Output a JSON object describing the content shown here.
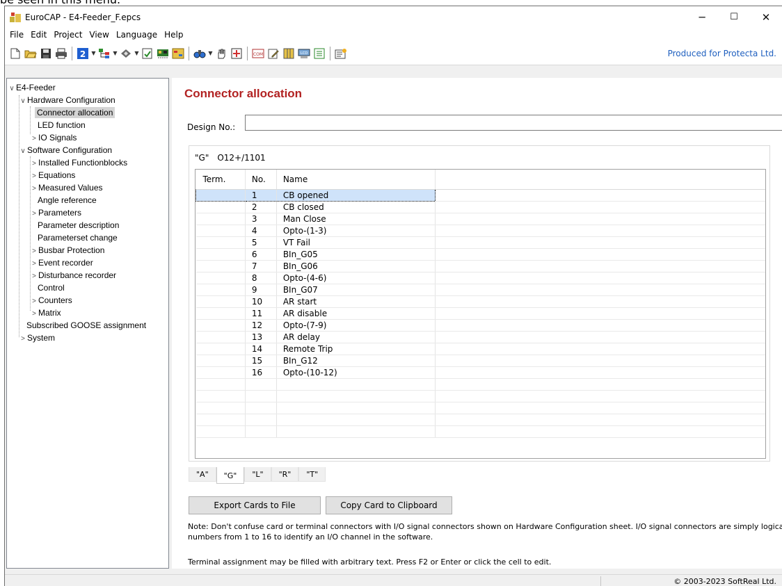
{
  "clipped_top_text": "be seen in this menu.",
  "window": {
    "title": "EuroCAP - E4-Feeder_F.epcs",
    "controls": {
      "minimize": "─",
      "maximize": "☐",
      "close": "✕"
    }
  },
  "menu": [
    "File",
    "Edit",
    "Project",
    "View",
    "Language",
    "Help"
  ],
  "toolbar": {
    "produced_for": "Produced for Protecta Ltd.",
    "icons": [
      "new-file-icon",
      "open-folder-icon",
      "save-icon",
      "print-icon",
      "number-badge-icon",
      "hardware-tree-icon",
      "component-icon",
      "document-check-icon",
      "io-card-icon",
      "configuration-icon",
      "binoculars-icon",
      "hand-icon",
      "zoom-fit-icon",
      "com-icon",
      "edit-icon",
      "columns-icon",
      "lcd-icon",
      "list-icon",
      "properties-icon"
    ],
    "badge_text": "2"
  },
  "tree": {
    "root": "E4-Feeder",
    "hardware": "Hardware Configuration",
    "connector": "Connector allocation",
    "led": "LED function",
    "io": "IO Signals",
    "software": "Software Configuration",
    "installed": "Installed Functionblocks",
    "equations": "Equations",
    "measured": "Measured Values",
    "angle": "Angle reference",
    "parameters": "Parameters",
    "paramdesc": "Parameter description",
    "paramset": "Parameterset change",
    "busbar": "Busbar Protection",
    "event": "Event recorder",
    "disturbance": "Disturbance recorder",
    "control": "Control",
    "counters": "Counters",
    "matrix": "Matrix",
    "goose": "Subscribed GOOSE assignment",
    "system": "System"
  },
  "page": {
    "title": "Connector allocation",
    "design_label": "Design No.:",
    "design_value": ""
  },
  "card": {
    "letter": "\"G\"",
    "code": "O12+/1101",
    "columns": [
      "Term.",
      "No.",
      "Name"
    ],
    "rows": [
      {
        "term": "",
        "no": "1",
        "name": "CB opened"
      },
      {
        "term": "",
        "no": "2",
        "name": "CB closed"
      },
      {
        "term": "",
        "no": "3",
        "name": "Man Close"
      },
      {
        "term": "",
        "no": "4",
        "name": "Opto-(1-3)"
      },
      {
        "term": "",
        "no": "5",
        "name": "VT Fail"
      },
      {
        "term": "",
        "no": "6",
        "name": "BIn_G05"
      },
      {
        "term": "",
        "no": "7",
        "name": "BIn_G06"
      },
      {
        "term": "",
        "no": "8",
        "name": "Opto-(4-6)"
      },
      {
        "term": "",
        "no": "9",
        "name": "BIn_G07"
      },
      {
        "term": "",
        "no": "10",
        "name": "AR start"
      },
      {
        "term": "",
        "no": "11",
        "name": "AR disable"
      },
      {
        "term": "",
        "no": "12",
        "name": "Opto-(7-9)"
      },
      {
        "term": "",
        "no": "13",
        "name": "AR delay"
      },
      {
        "term": "",
        "no": "14",
        "name": "Remote Trip"
      },
      {
        "term": "",
        "no": "15",
        "name": "BIn_G12"
      },
      {
        "term": "",
        "no": "16",
        "name": "Opto-(10-12)"
      }
    ],
    "tabs": [
      "\"A\"",
      "\"G\"",
      "\"L\"",
      "\"R\"",
      "\"T\""
    ],
    "active_tab": "\"G\""
  },
  "buttons": {
    "export": "Export Cards to File",
    "copy": "Copy Card to Clipboard"
  },
  "notes": {
    "line1": "Note:  Don't confuse card or terminal connectors with I/O signal connectors shown on Hardware Configuration sheet. I/O signal connectors are simply logical",
    "line2": "numbers from 1 to 16 to identify an I/O channel in the software.",
    "line3": "Terminal assignment may be filled with arbitrary text. Press F2 or Enter or click the cell to edit."
  },
  "status": {
    "copyright": "© 2003-2023 SoftReal Ltd."
  }
}
